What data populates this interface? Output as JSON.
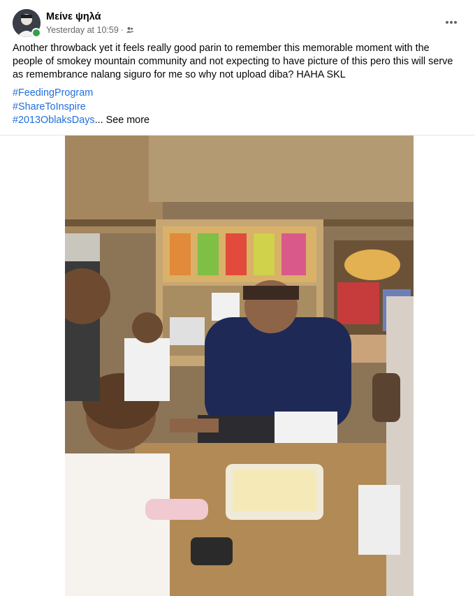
{
  "post": {
    "author": "Μείνε ψηλά",
    "timestamp": "Yesterday at 10:59",
    "audience_icon": "friends-icon",
    "text": "Another throwback yet it feels really good parin to remember this memorable moment with the people of smokey mountain community and not expecting to have picture of this pero this will serve as remembrance nalang siguro for me so why not upload diba? HAHA SKL",
    "hashtags": [
      "#FeedingProgram",
      "#ShareToInspire",
      "#2013OblaksDays"
    ],
    "truncation": "...",
    "see_more": "See more"
  },
  "icons": {
    "more": "more-horizontal-icon",
    "online": "online-status-icon"
  },
  "colors": {
    "link": "#216fdb",
    "secondary_text": "#65676b",
    "online": "#31a24c"
  }
}
